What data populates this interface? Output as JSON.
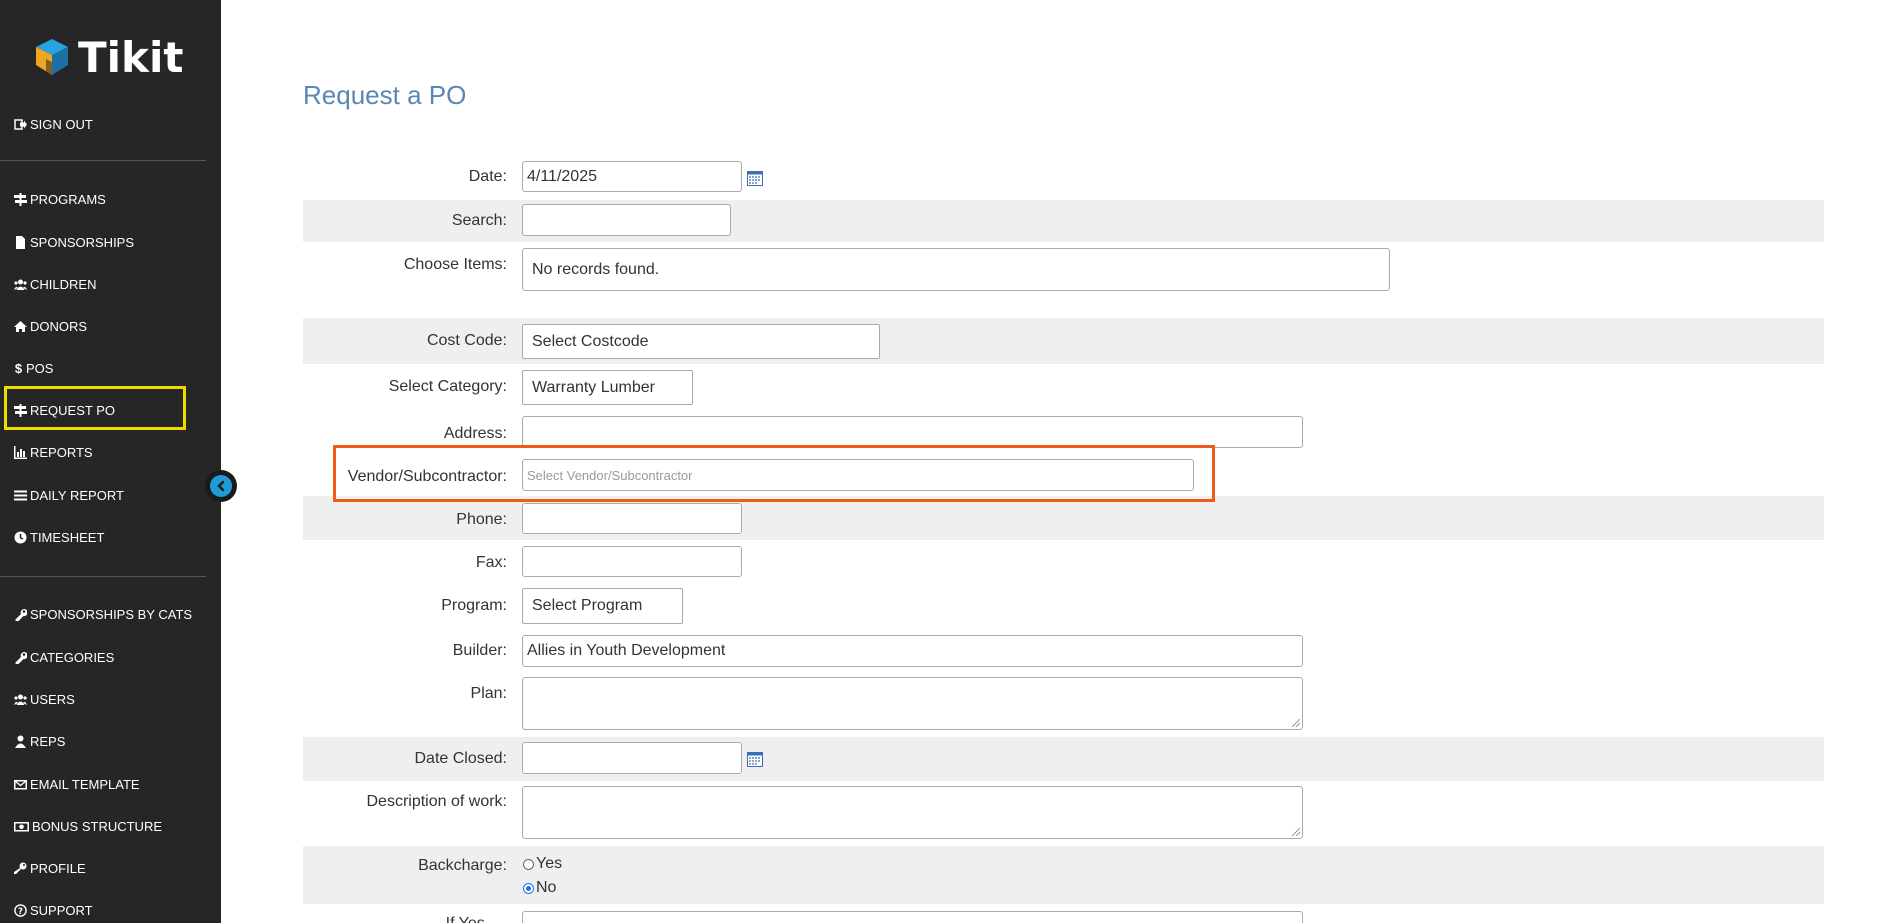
{
  "app": {
    "logo_text": "Tikit"
  },
  "sidebar": {
    "sign_out": "SIGN OUT",
    "items": [
      {
        "label": "PROGRAMS",
        "icon": "signpost-icon"
      },
      {
        "label": "SPONSORSHIPS",
        "icon": "file-icon"
      },
      {
        "label": "CHILDREN",
        "icon": "users-icon"
      },
      {
        "label": "DONORS",
        "icon": "home-icon"
      },
      {
        "label": "POS",
        "icon": "dollar-icon"
      },
      {
        "label": "REQUEST PO",
        "icon": "signpost-icon",
        "active": true
      },
      {
        "label": "REPORTS",
        "icon": "chart-icon"
      },
      {
        "label": "DAILY REPORT",
        "icon": "list-icon"
      },
      {
        "label": "TIMESHEET",
        "icon": "clock-icon"
      }
    ],
    "admin_items": [
      {
        "label": "SPONSORSHIPS BY CATS",
        "icon": "wrench-icon"
      },
      {
        "label": "CATEGORIES",
        "icon": "wrench-icon"
      },
      {
        "label": "USERS",
        "icon": "users-icon"
      },
      {
        "label": "REPS",
        "icon": "user-icon"
      },
      {
        "label": "EMAIL TEMPLATE",
        "icon": "envelope-icon"
      },
      {
        "label": "BONUS STRUCTURE",
        "icon": "money-icon"
      },
      {
        "label": "PROFILE",
        "icon": "key-icon"
      },
      {
        "label": "SUPPORT",
        "icon": "question-icon"
      }
    ]
  },
  "form": {
    "title": "Request a PO",
    "date": {
      "label": "Date:",
      "value": "4/11/2025"
    },
    "search": {
      "label": "Search:",
      "value": ""
    },
    "choose_items": {
      "label": "Choose Items:",
      "value": "No records found."
    },
    "cost_code": {
      "label": "Cost Code:",
      "value": "Select Costcode"
    },
    "category": {
      "label": "Select Category:",
      "value": "Warranty Lumber"
    },
    "address": {
      "label": "Address:",
      "value": ""
    },
    "vendor": {
      "label": "Vendor/Subcontractor:",
      "placeholder": "Select Vendor/Subcontractor"
    },
    "phone": {
      "label": "Phone:",
      "value": ""
    },
    "fax": {
      "label": "Fax:",
      "value": ""
    },
    "program": {
      "label": "Program:",
      "value": "Select Program"
    },
    "builder": {
      "label": "Builder:",
      "value": "Allies in Youth Development"
    },
    "plan": {
      "label": "Plan:",
      "value": ""
    },
    "date_closed": {
      "label": "Date Closed:",
      "value": ""
    },
    "description": {
      "label": "Description of work:",
      "value": ""
    },
    "backcharge": {
      "label": "Backcharge:",
      "options": [
        "Yes",
        "No"
      ],
      "selected": "No"
    },
    "if_yes": {
      "label": "If Yes, ..."
    }
  },
  "colors": {
    "sidebar_bg": "#262626",
    "active_outline": "#f2da00",
    "focus_outline": "#f05a1a",
    "title": "#5b87b3",
    "row_shade": "#efefef"
  }
}
